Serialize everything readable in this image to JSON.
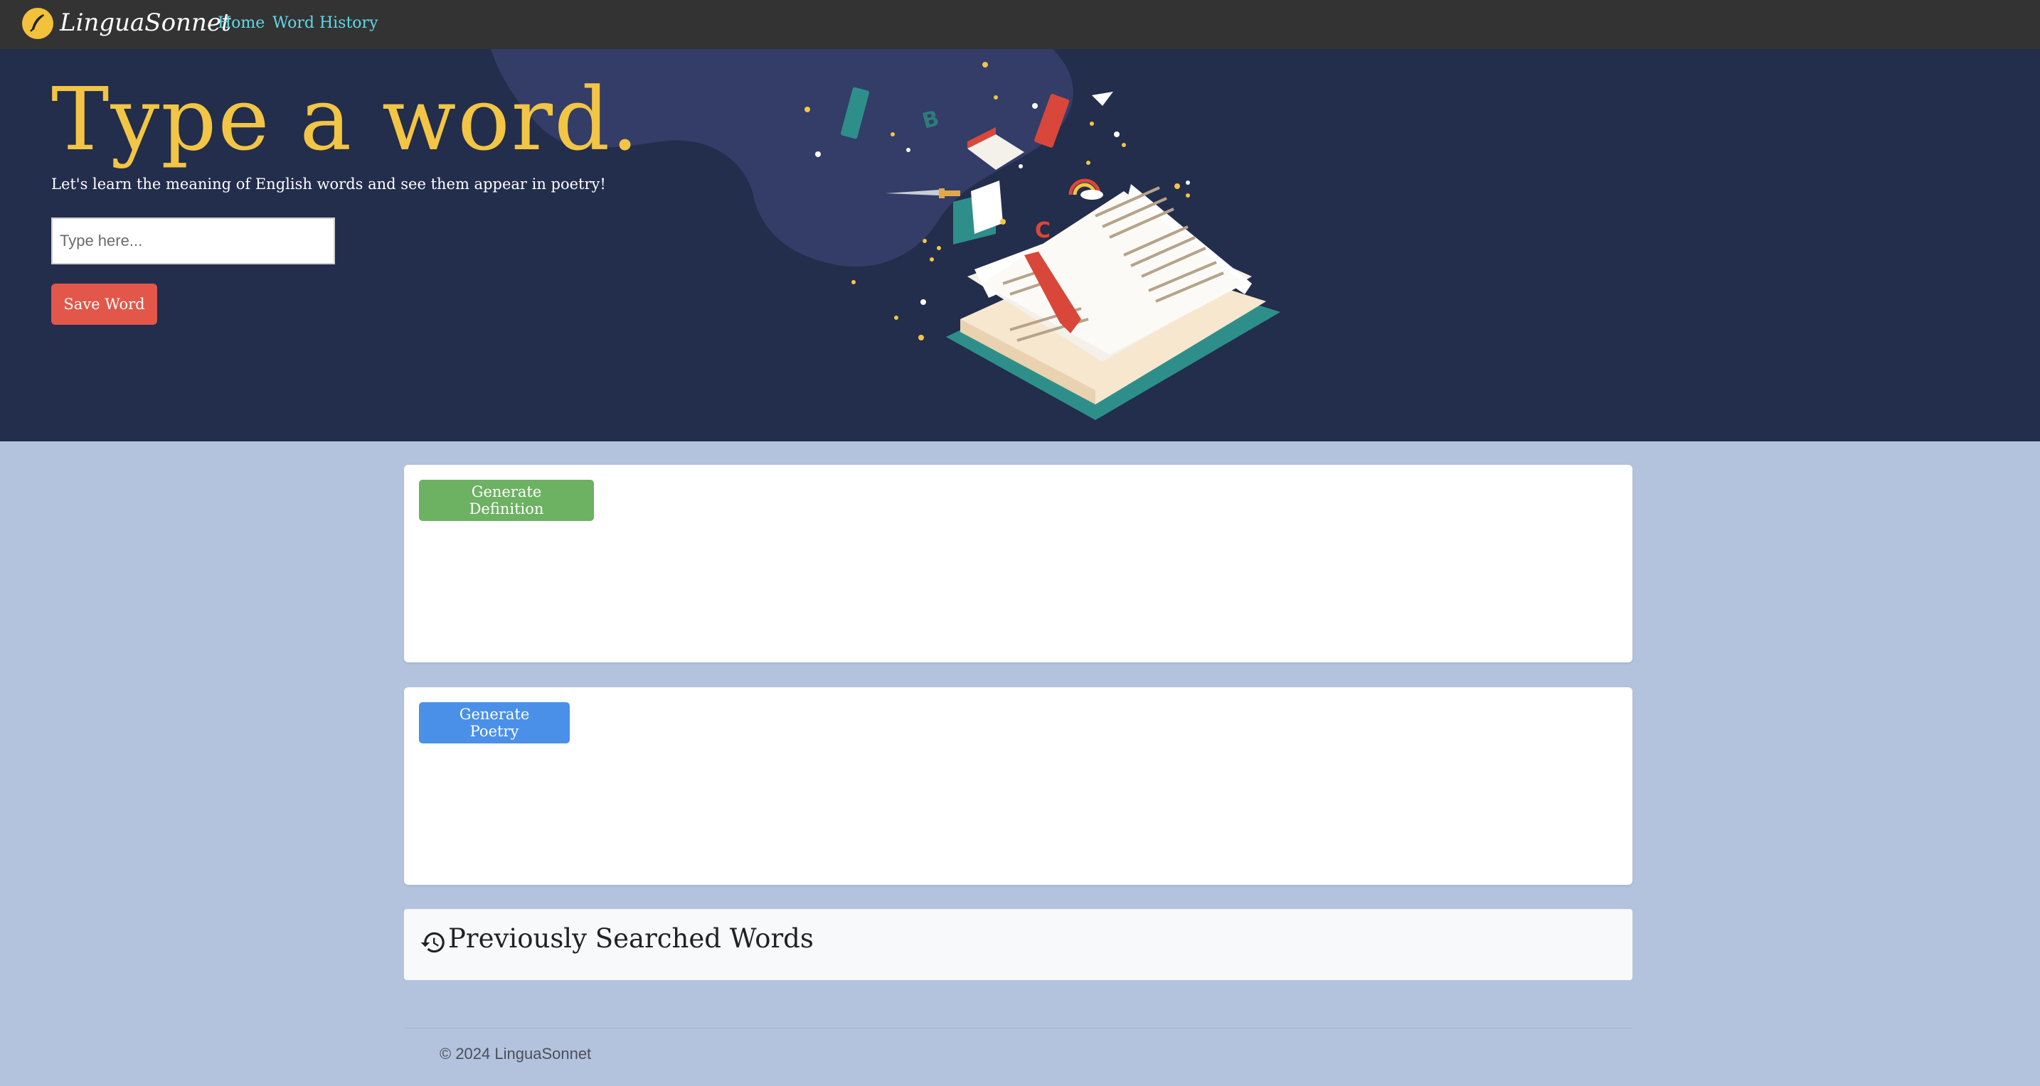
{
  "navbar": {
    "brand": "LinguaSonnet",
    "links": [
      {
        "label": "Home"
      },
      {
        "label": "Word History"
      }
    ]
  },
  "hero": {
    "title": "Type a word.",
    "subtitle": "Let's learn the meaning of English words and see them appear in poetry!",
    "input_placeholder": "Type here...",
    "input_value": "",
    "save_label": "Save Word"
  },
  "definition_card": {
    "button_label": "Generate Definition"
  },
  "poetry_card": {
    "button_label": "Generate Poetry"
  },
  "history": {
    "title": "Previously Searched Words",
    "icon": "history-icon"
  },
  "footer": {
    "text": "© 2024 LinguaSonnet"
  },
  "colors": {
    "navbar_bg": "#333333",
    "hero_bg": "#232d4c",
    "title_color": "#f2c544",
    "nav_link": "#5fd8e6",
    "save_button": "#e2574a",
    "definition_button": "#6db163",
    "poetry_button": "#4a90e8",
    "page_bg": "#b3c3de"
  }
}
